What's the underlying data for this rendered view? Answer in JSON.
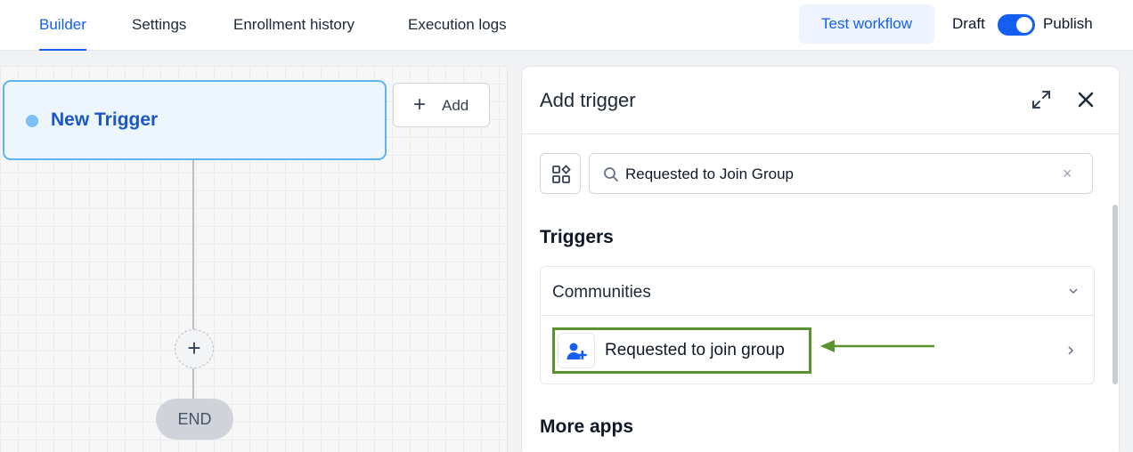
{
  "nav": {
    "tabs": [
      {
        "label": "Builder",
        "active": true
      },
      {
        "label": "Settings",
        "active": false
      },
      {
        "label": "Enrollment history",
        "active": false
      },
      {
        "label": "Execution logs",
        "active": false
      }
    ],
    "test_button": "Test workflow",
    "draft_label": "Draft",
    "publish_label": "Publish",
    "publish_toggle_on": true
  },
  "canvas": {
    "trigger_node_label": "New Trigger",
    "add_button_label": "Add",
    "end_label": "END"
  },
  "panel": {
    "title": "Add trigger",
    "search": {
      "value": "Requested to Join Group"
    },
    "triggers_heading": "Triggers",
    "group": {
      "title": "Communities",
      "items": [
        {
          "label": "Requested to join group",
          "icon": "user-add-icon"
        }
      ]
    },
    "more_apps_heading": "More apps"
  },
  "colors": {
    "accent": "#155eef",
    "trigger_border": "#5eb3f2",
    "highlight": "#5a922e"
  }
}
